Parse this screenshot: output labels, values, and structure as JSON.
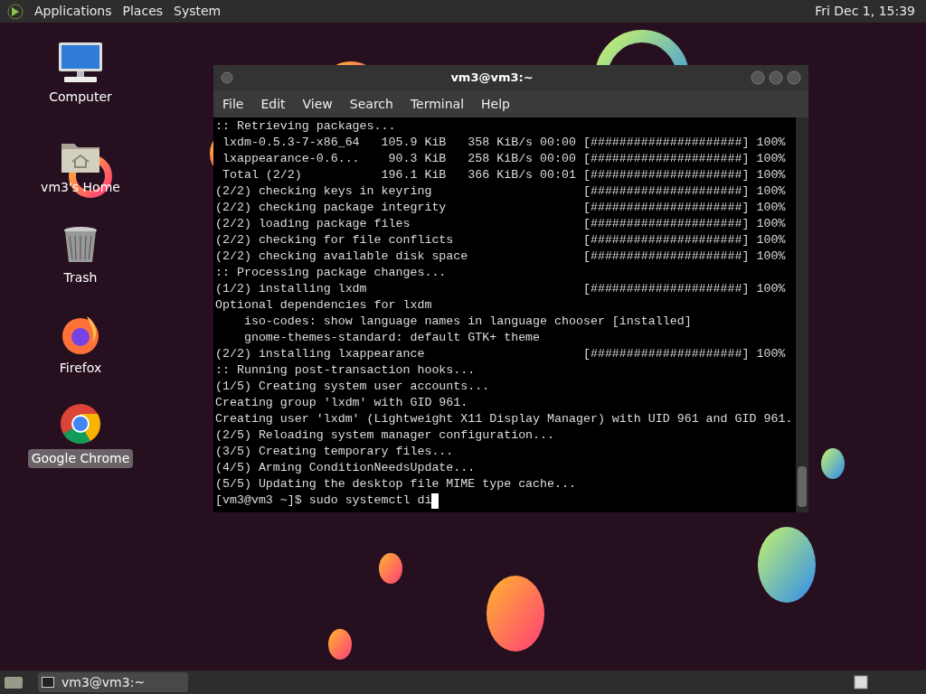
{
  "top_panel": {
    "menus": [
      "Applications",
      "Places",
      "System"
    ],
    "clock": "Fri Dec 1, 15:39"
  },
  "desktop_icons": [
    {
      "kind": "computer",
      "label": "Computer",
      "selected": false
    },
    {
      "kind": "home",
      "label": "vm3's Home",
      "selected": false
    },
    {
      "kind": "trash",
      "label": "Trash",
      "selected": false
    },
    {
      "kind": "firefox",
      "label": "Firefox",
      "selected": false
    },
    {
      "kind": "chrome",
      "label": "Google Chrome",
      "selected": true
    }
  ],
  "terminal": {
    "title": "vm3@vm3:~",
    "menu": [
      "File",
      "Edit",
      "View",
      "Search",
      "Terminal",
      "Help"
    ],
    "lines": [
      {
        "text": ":: Retrieving packages..."
      },
      {
        "text": " lxdm-0.5.3-7-x86_64   105.9 KiB   358 KiB/s 00:00",
        "bar": "[#####################] 100%"
      },
      {
        "text": " lxappearance-0.6...    90.3 KiB   258 KiB/s 00:00",
        "bar": "[#####################] 100%"
      },
      {
        "text": " Total (2/2)           196.1 KiB   366 KiB/s 00:01",
        "bar": "[#####################] 100%"
      },
      {
        "text": "(2/2) checking keys in keyring",
        "bar": "[#####################] 100%"
      },
      {
        "text": "(2/2) checking package integrity",
        "bar": "[#####################] 100%"
      },
      {
        "text": "(2/2) loading package files",
        "bar": "[#####################] 100%"
      },
      {
        "text": "(2/2) checking for file conflicts",
        "bar": "[#####################] 100%"
      },
      {
        "text": "(2/2) checking available disk space",
        "bar": "[#####################] 100%"
      },
      {
        "text": ":: Processing package changes..."
      },
      {
        "text": "(1/2) installing lxdm",
        "bar": "[#####################] 100%"
      },
      {
        "text": "Optional dependencies for lxdm"
      },
      {
        "text": "    iso-codes: show language names in language chooser [installed]"
      },
      {
        "text": "    gnome-themes-standard: default GTK+ theme"
      },
      {
        "text": "(2/2) installing lxappearance",
        "bar": "[#####################] 100%"
      },
      {
        "text": ":: Running post-transaction hooks..."
      },
      {
        "text": "(1/5) Creating system user accounts..."
      },
      {
        "text": "Creating group 'lxdm' with GID 961."
      },
      {
        "text": "Creating user 'lxdm' (Lightweight X11 Display Manager) with UID 961 and GID 961."
      },
      {
        "text": "(2/5) Reloading system manager configuration..."
      },
      {
        "text": "(3/5) Creating temporary files..."
      },
      {
        "text": "(4/5) Arming ConditionNeedsUpdate..."
      },
      {
        "text": "(5/5) Updating the desktop file MIME type cache..."
      }
    ],
    "prompt": "[vm3@vm3 ~]$ sudo systemctl di"
  },
  "taskbar": {
    "tasks": [
      {
        "label": "vm3@vm3:~",
        "selected": false
      }
    ]
  }
}
